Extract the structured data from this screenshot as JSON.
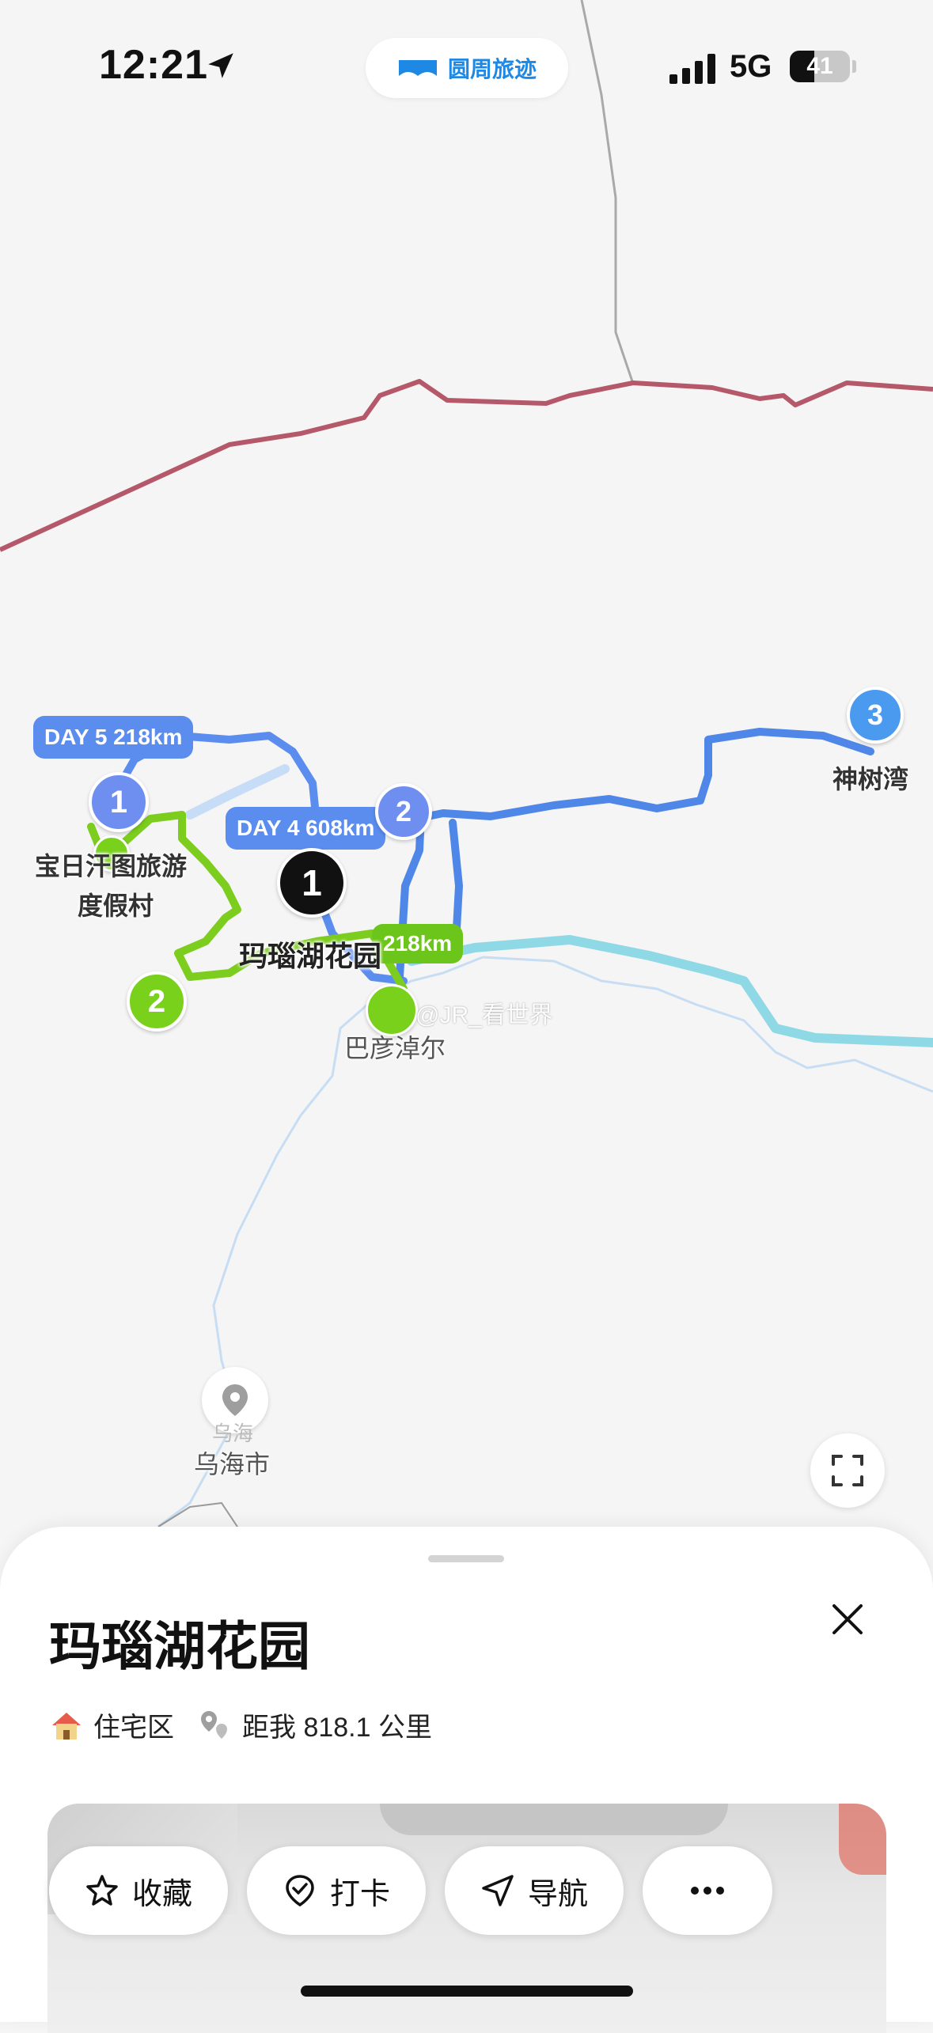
{
  "status_bar": {
    "time": "12:21",
    "app_name": "圆周旅迹",
    "network": "5G",
    "battery": "41",
    "battery_level": 0.41
  },
  "map": {
    "day_labels": [
      {
        "text": "DAY 5 218km",
        "color": "#5b8def"
      },
      {
        "text": "DAY 4 608km",
        "color": "#5b8def"
      },
      {
        "text": "218km",
        "color": "#6cc51a"
      }
    ],
    "markers": [
      {
        "label": "1",
        "color": "#6f8ff0"
      },
      {
        "label": "1",
        "color": "#111111"
      },
      {
        "label": "2",
        "color": "#79d11b"
      },
      {
        "label": "2",
        "color": "#6f8ff0"
      },
      {
        "label": "3",
        "color": "#4a9af0"
      }
    ],
    "place_labels": {
      "resort_line1": "宝日汗图旅游",
      "resort_line2": "度假村",
      "garden": "玛瑙湖花园",
      "bayannur": "巴彦淖尔",
      "shenshuwan": "神树湾",
      "wuhai": "乌海市",
      "wuhai_sub": "乌海"
    },
    "watermark": "@JR_看世界",
    "icons": {
      "city_pin": "location-pin-icon",
      "fullscreen": "fullscreen-icon"
    }
  },
  "sheet": {
    "title": "玛瑙湖花园",
    "category": "住宅区",
    "distance": "距我 818.1 公里",
    "actions": [
      {
        "label": "收藏",
        "icon": "star-icon"
      },
      {
        "label": "打卡",
        "icon": "check-badge-icon"
      },
      {
        "label": "导航",
        "icon": "navigate-icon"
      },
      {
        "label": "",
        "icon": "more-icon"
      }
    ]
  }
}
